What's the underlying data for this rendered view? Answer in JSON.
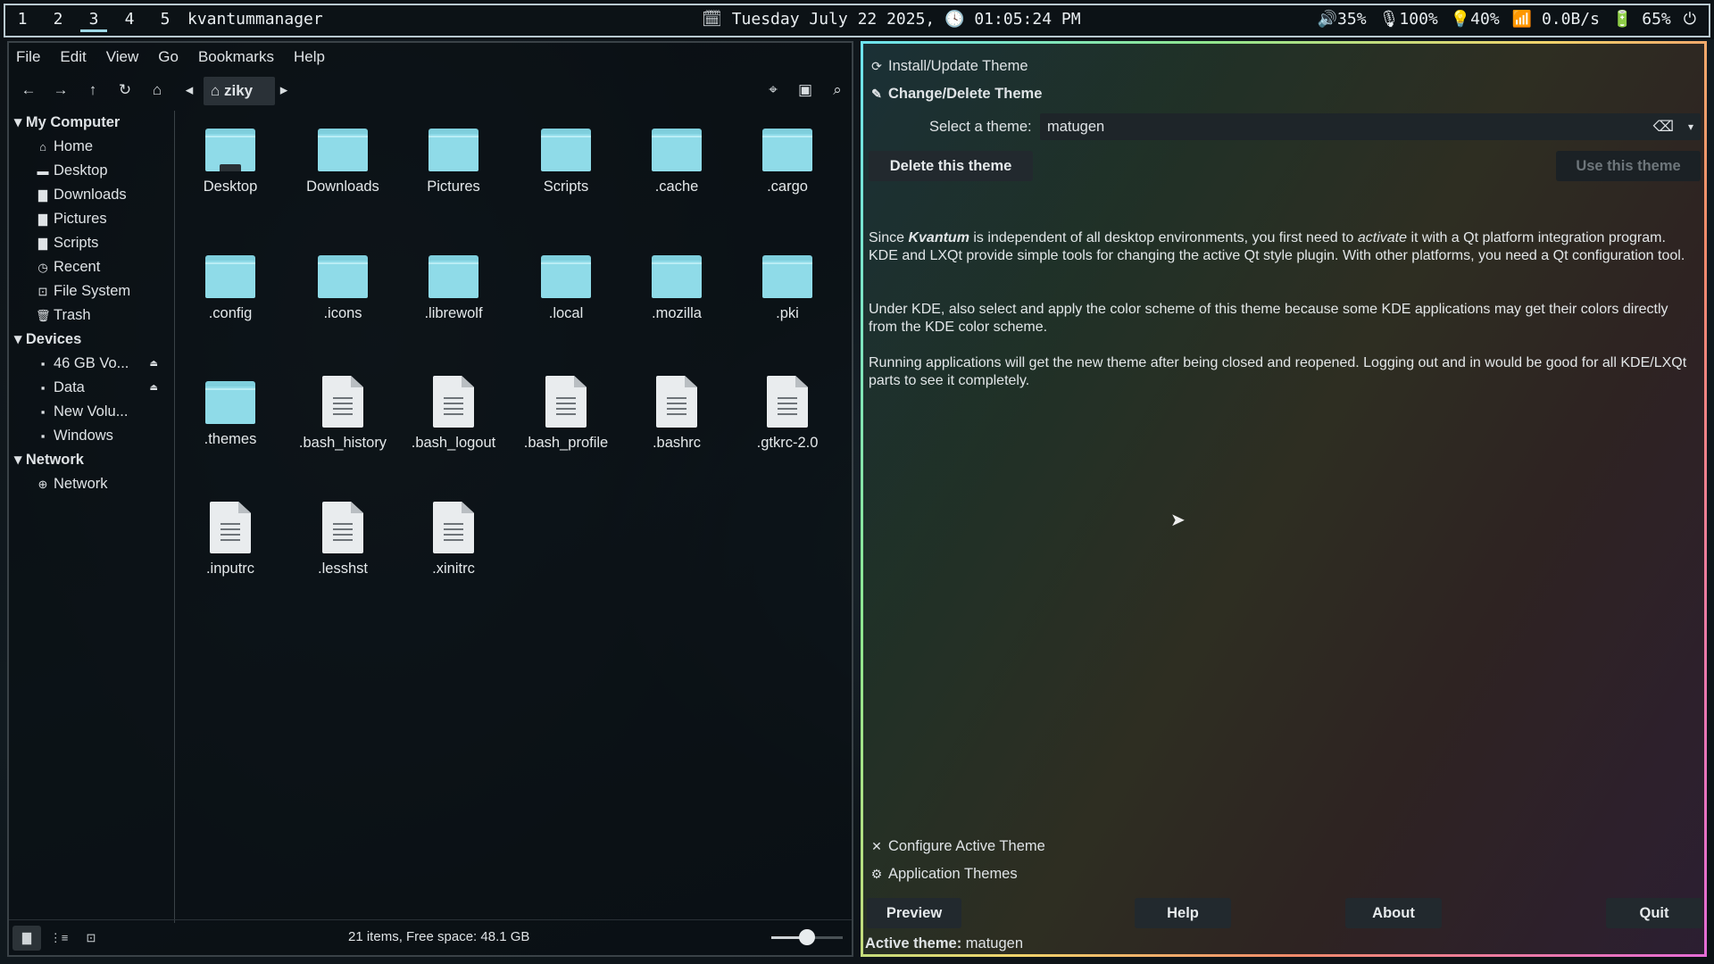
{
  "topbar": {
    "workspaces": [
      "1",
      "2",
      "3",
      "4",
      "5"
    ],
    "active_workspace": "3",
    "app_title": "kvantummanager",
    "clock": "🗓 Tuesday July 22 2025, 🕓 01:05:24 PM",
    "volume": "🔊35%",
    "mic": "🎙100%",
    "brightness": "💡40%",
    "network": "📶 0.0B/s",
    "battery": "🔋 65%",
    "power_icon": "⏻"
  },
  "filemanager": {
    "menu": [
      "File",
      "Edit",
      "View",
      "Go",
      "Bookmarks",
      "Help"
    ],
    "breadcrumb": "⌂ ziky",
    "sidebar": {
      "my_computer": "My Computer",
      "places": [
        {
          "icon": "⌂",
          "label": "Home"
        },
        {
          "icon": "▬",
          "label": "Desktop"
        },
        {
          "icon": "▇",
          "label": "Downloads"
        },
        {
          "icon": "▇",
          "label": "Pictures"
        },
        {
          "icon": "▇",
          "label": "Scripts"
        },
        {
          "icon": "◷",
          "label": "Recent"
        },
        {
          "icon": "⊡",
          "label": "File System"
        },
        {
          "icon": "🗑",
          "label": "Trash"
        }
      ],
      "devices_header": "Devices",
      "devices": [
        {
          "label": "46 GB Vo...",
          "eject": "⏏"
        },
        {
          "label": "Data",
          "eject": "⏏"
        },
        {
          "label": "New Volu...",
          "eject": ""
        },
        {
          "label": "Windows",
          "eject": ""
        }
      ],
      "network_header": "Network",
      "network": [
        {
          "icon": "⊕",
          "label": "Network"
        }
      ]
    },
    "items": [
      {
        "name": "Desktop",
        "kind": "folder-desktop"
      },
      {
        "name": "Downloads",
        "kind": "folder"
      },
      {
        "name": "Pictures",
        "kind": "folder"
      },
      {
        "name": "Scripts",
        "kind": "folder"
      },
      {
        "name": ".cache",
        "kind": "folder"
      },
      {
        "name": ".cargo",
        "kind": "folder"
      },
      {
        "name": ".config",
        "kind": "folder"
      },
      {
        "name": ".icons",
        "kind": "folder"
      },
      {
        "name": ".librewolf",
        "kind": "folder"
      },
      {
        "name": ".local",
        "kind": "folder"
      },
      {
        "name": ".mozilla",
        "kind": "folder"
      },
      {
        "name": ".pki",
        "kind": "folder"
      },
      {
        "name": ".themes",
        "kind": "folder"
      },
      {
        "name": ".bash_history",
        "kind": "file"
      },
      {
        "name": ".bash_logout",
        "kind": "file"
      },
      {
        "name": ".bash_profile",
        "kind": "file"
      },
      {
        "name": ".bashrc",
        "kind": "file"
      },
      {
        "name": ".gtkrc-2.0",
        "kind": "file"
      },
      {
        "name": ".inputrc",
        "kind": "file"
      },
      {
        "name": ".lesshst",
        "kind": "file"
      },
      {
        "name": ".xinitrc",
        "kind": "file"
      }
    ],
    "status_text": "21 items, Free space: 48.1 GB",
    "zoom_fraction": 0.5
  },
  "kvantum": {
    "install_update": "Install/Update Theme",
    "change_delete": "Change/Delete Theme",
    "select_label": "Select a theme:",
    "selected_theme": "matugen",
    "delete_button": "Delete this theme",
    "use_button": "Use this theme",
    "para1_a": "Since ",
    "para1_b": "Kvantum",
    "para1_c": " is independent of all desktop environments, you first need to ",
    "para1_d": "activate",
    "para1_e": " it with a Qt platform integration program. KDE and LXQt provide simple tools for changing the active Qt style plugin. With other platforms, you need a Qt configuration tool.",
    "para2": "Under KDE, also select and apply the color scheme of this theme because some KDE applications may get their colors directly from the KDE color scheme.",
    "para3": "Running applications will get the new theme after being closed and reopened. Logging out and in would be good for all KDE/LXQt parts to see it completely.",
    "configure": "Configure Active Theme",
    "app_themes": "Application Themes",
    "preview": "Preview",
    "help": "Help",
    "about": "About",
    "quit": "Quit",
    "active_label": "Active theme:",
    "active_value": "matugen"
  }
}
